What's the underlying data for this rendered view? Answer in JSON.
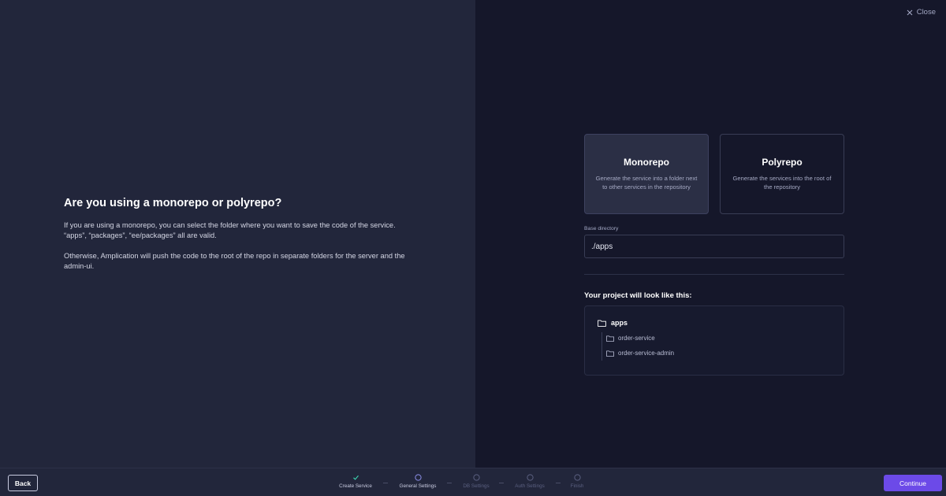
{
  "intro": {
    "heading": "Are you using a monorepo or polyrepo?",
    "paragraph_1": "If you are using a monorepo, you can select the folder where you want to save the code of the service. “apps”, “packages”, “ee/packages” all are valid.",
    "paragraph_2": "Otherwise, Amplication will push the code to the root of the repo in separate folders for the server and the admin-ui."
  },
  "header": {
    "close_label": "Close"
  },
  "options": {
    "monorepo": {
      "title": "Monorepo",
      "description": "Generate the service into a folder next to other services in the repository",
      "selected": true
    },
    "polyrepo": {
      "title": "Polyrepo",
      "description": "Generate the services into the root of the repository",
      "selected": false
    }
  },
  "base_directory": {
    "label": "Base directory",
    "value": "./apps"
  },
  "preview": {
    "title": "Your project will look like this:",
    "root_folder": "apps",
    "children": [
      "order-service",
      "order-service-admin"
    ]
  },
  "footer": {
    "back_label": "Back",
    "continue_label": "Continue",
    "steps": [
      {
        "label": "Create Service",
        "state": "done"
      },
      {
        "label": "General Settings",
        "state": "current"
      },
      {
        "label": "DB Settings",
        "state": "upcoming"
      },
      {
        "label": "Auth Settings",
        "state": "upcoming"
      },
      {
        "label": "Finish",
        "state": "upcoming"
      }
    ]
  },
  "colors": {
    "accent": "#6c4ae8",
    "check": "#3dd9b4",
    "current_step": "#8c8fe8",
    "left_panel_bg": "#22263b",
    "right_panel_bg": "#15172a"
  },
  "icons": {
    "close": "close-icon",
    "folder": "folder-icon",
    "step_done": "check-icon",
    "step_pending": "circle-icon"
  }
}
